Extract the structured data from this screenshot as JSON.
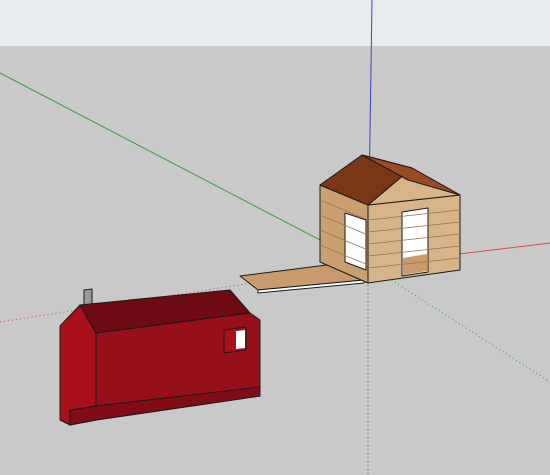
{
  "viewport": {
    "colors": {
      "sky": "#e9ecee",
      "ground": "#c9c9c9",
      "axis_red": "#d84848",
      "axis_green": "#3aa03a",
      "axis_blue": "#4040c8"
    }
  },
  "models": [
    {
      "name": "wood-shed",
      "colors": {
        "roof": "#9a4b24",
        "roof_dark": "#7a3716",
        "wall_light": "#d8b48a",
        "wall_mid": "#caa071",
        "plank_line": "#9b7448",
        "floor": "#c89a6c",
        "interior": "#ffffff",
        "outline": "#1a1a1a"
      }
    },
    {
      "name": "red-cabin",
      "colors": {
        "front": "#a8101a",
        "side": "#96101a",
        "roof": "#6e0a12",
        "roof_front": "#820c15",
        "chimney": "#9a9a9a",
        "window": "#ffffff",
        "outline": "#1a1a1a"
      }
    }
  ]
}
